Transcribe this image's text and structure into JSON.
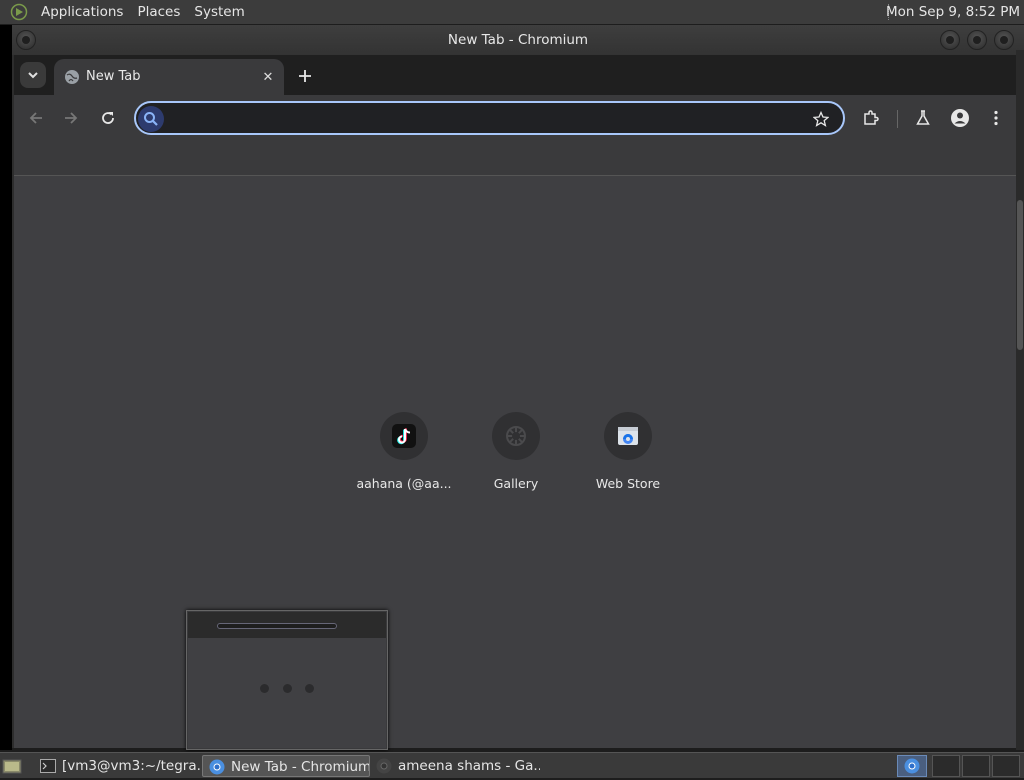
{
  "top_panel": {
    "menus": [
      "Applications",
      "Places",
      "System"
    ],
    "clock": "Mon Sep  9,  8:52 PM"
  },
  "window": {
    "title": "New Tab - Chromium"
  },
  "tabs": [
    {
      "title": "New Tab",
      "favicon": "globe-icon"
    }
  ],
  "omnibox": {
    "value": "",
    "placeholder": ""
  },
  "shortcuts": [
    {
      "label": "aahana (@aa...",
      "icon": "tiktok-icon"
    },
    {
      "label": "Gallery",
      "icon": "gallery-icon"
    },
    {
      "label": "Web Store",
      "icon": "webstore-icon"
    }
  ],
  "taskbar": {
    "tasks": [
      {
        "label": "[vm3@vm3:~/tegra...",
        "icon": "terminal-icon"
      },
      {
        "label": "New Tab - Chromium",
        "icon": "chromium-icon",
        "active": true
      },
      {
        "label": "ameena shams - Ga...",
        "icon": "chromium-icon"
      }
    ]
  },
  "colors": {
    "accent": "#a8c7fa",
    "panel": "#3c3c3c",
    "content_bg": "#3f3f42"
  }
}
